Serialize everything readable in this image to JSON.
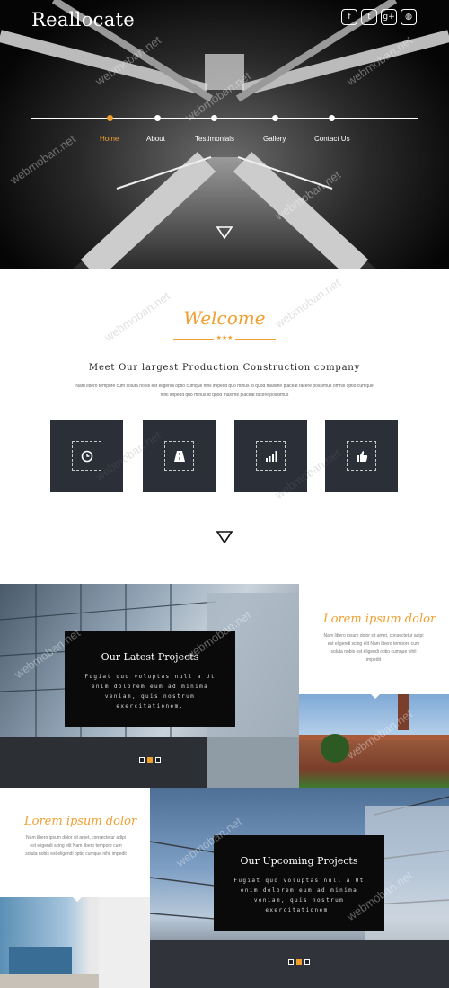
{
  "header": {
    "logo": "Reallocate",
    "social": [
      {
        "icon": "facebook-icon",
        "glyph": "f"
      },
      {
        "icon": "twitter-icon",
        "glyph": "t"
      },
      {
        "icon": "google-plus-icon",
        "glyph": "g+"
      },
      {
        "icon": "dribbble-icon",
        "glyph": "◍"
      }
    ],
    "nav": [
      "Home",
      "About",
      "Testimonials",
      "Gallery",
      "Contact Us"
    ],
    "active_nav": "Home"
  },
  "welcome": {
    "title": "Welcome",
    "stars": "★★★",
    "subtitle": "Meet Our largest Production Construction company",
    "paragraph": "Nam libero tempore cum soluta nobis est eligendi optio cumque nihil impedit quo minus id quod maxime placeat facere possimus omnis optio cumque nihil impedit quo minus id quod maxime placeat facere possimus",
    "features": [
      {
        "icon": "clock-icon"
      },
      {
        "icon": "road-icon"
      },
      {
        "icon": "bar-chart-icon"
      },
      {
        "icon": "thumbs-up-icon"
      }
    ]
  },
  "projects": {
    "latest": {
      "title": "Our Latest Projects",
      "text": "Fugiat quo voluptas null a Ut enim dolorem eum ad minima veniam, quis nostrum exercitationem."
    },
    "lorem1": {
      "title": "Lorem ipsum dolor",
      "text": "Nam libero ipsum dolor sit amet, consectetur adipi est eligendi scing elit Nam libero tempore cum soluta nobis est eligendi optio cumque nihil impedit"
    },
    "lorem2": {
      "title": "Lorem ipsum dolor",
      "text": "Nam libero ipsum dolor sit amet, consectetur adipi est eligendi scing elit Nam libero tempore cum soluta nobis est eligendi optio cumque nihil impedit"
    },
    "upcoming": {
      "title": "Our Upcoming Projects",
      "text": "Fugiat quo voluptas null a Ut enim dolorem eum ad minima veniam, quis nostrum exercitationem."
    }
  },
  "watermark": "webmoban.net",
  "colors": {
    "accent": "#f0a030",
    "feature_bg": "#2b2f38"
  }
}
